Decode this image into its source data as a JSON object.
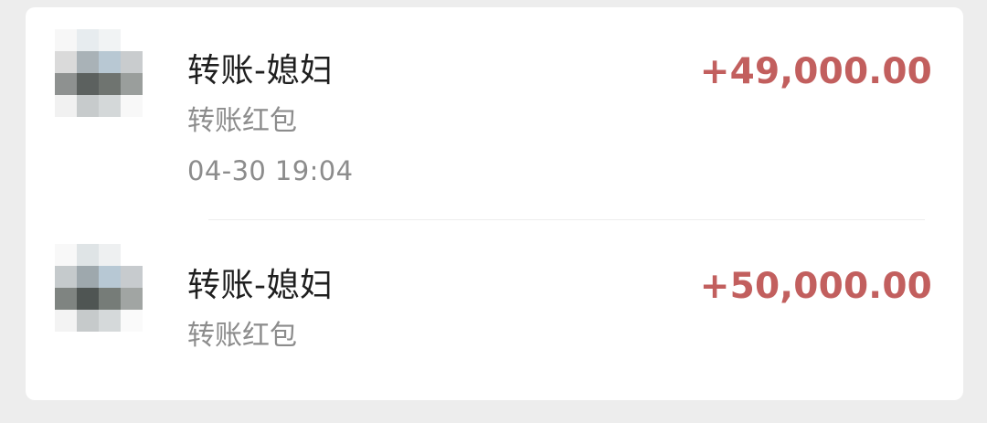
{
  "transactions": [
    {
      "title": "转账-媳妇",
      "subtitle": "转账红包",
      "datetime": "04-30 19:04",
      "amount": "+49,000.00"
    },
    {
      "title": "转账-媳妇",
      "subtitle": "转账红包",
      "amount": "+50,000.00"
    }
  ],
  "colors": {
    "amount": "#c25f5e",
    "title": "#1f1f1f",
    "secondary": "#8c8c8c",
    "card_background": "#ffffff",
    "page_background": "#ededed"
  },
  "icons": {
    "avatar": "blurred-avatar-icon"
  }
}
